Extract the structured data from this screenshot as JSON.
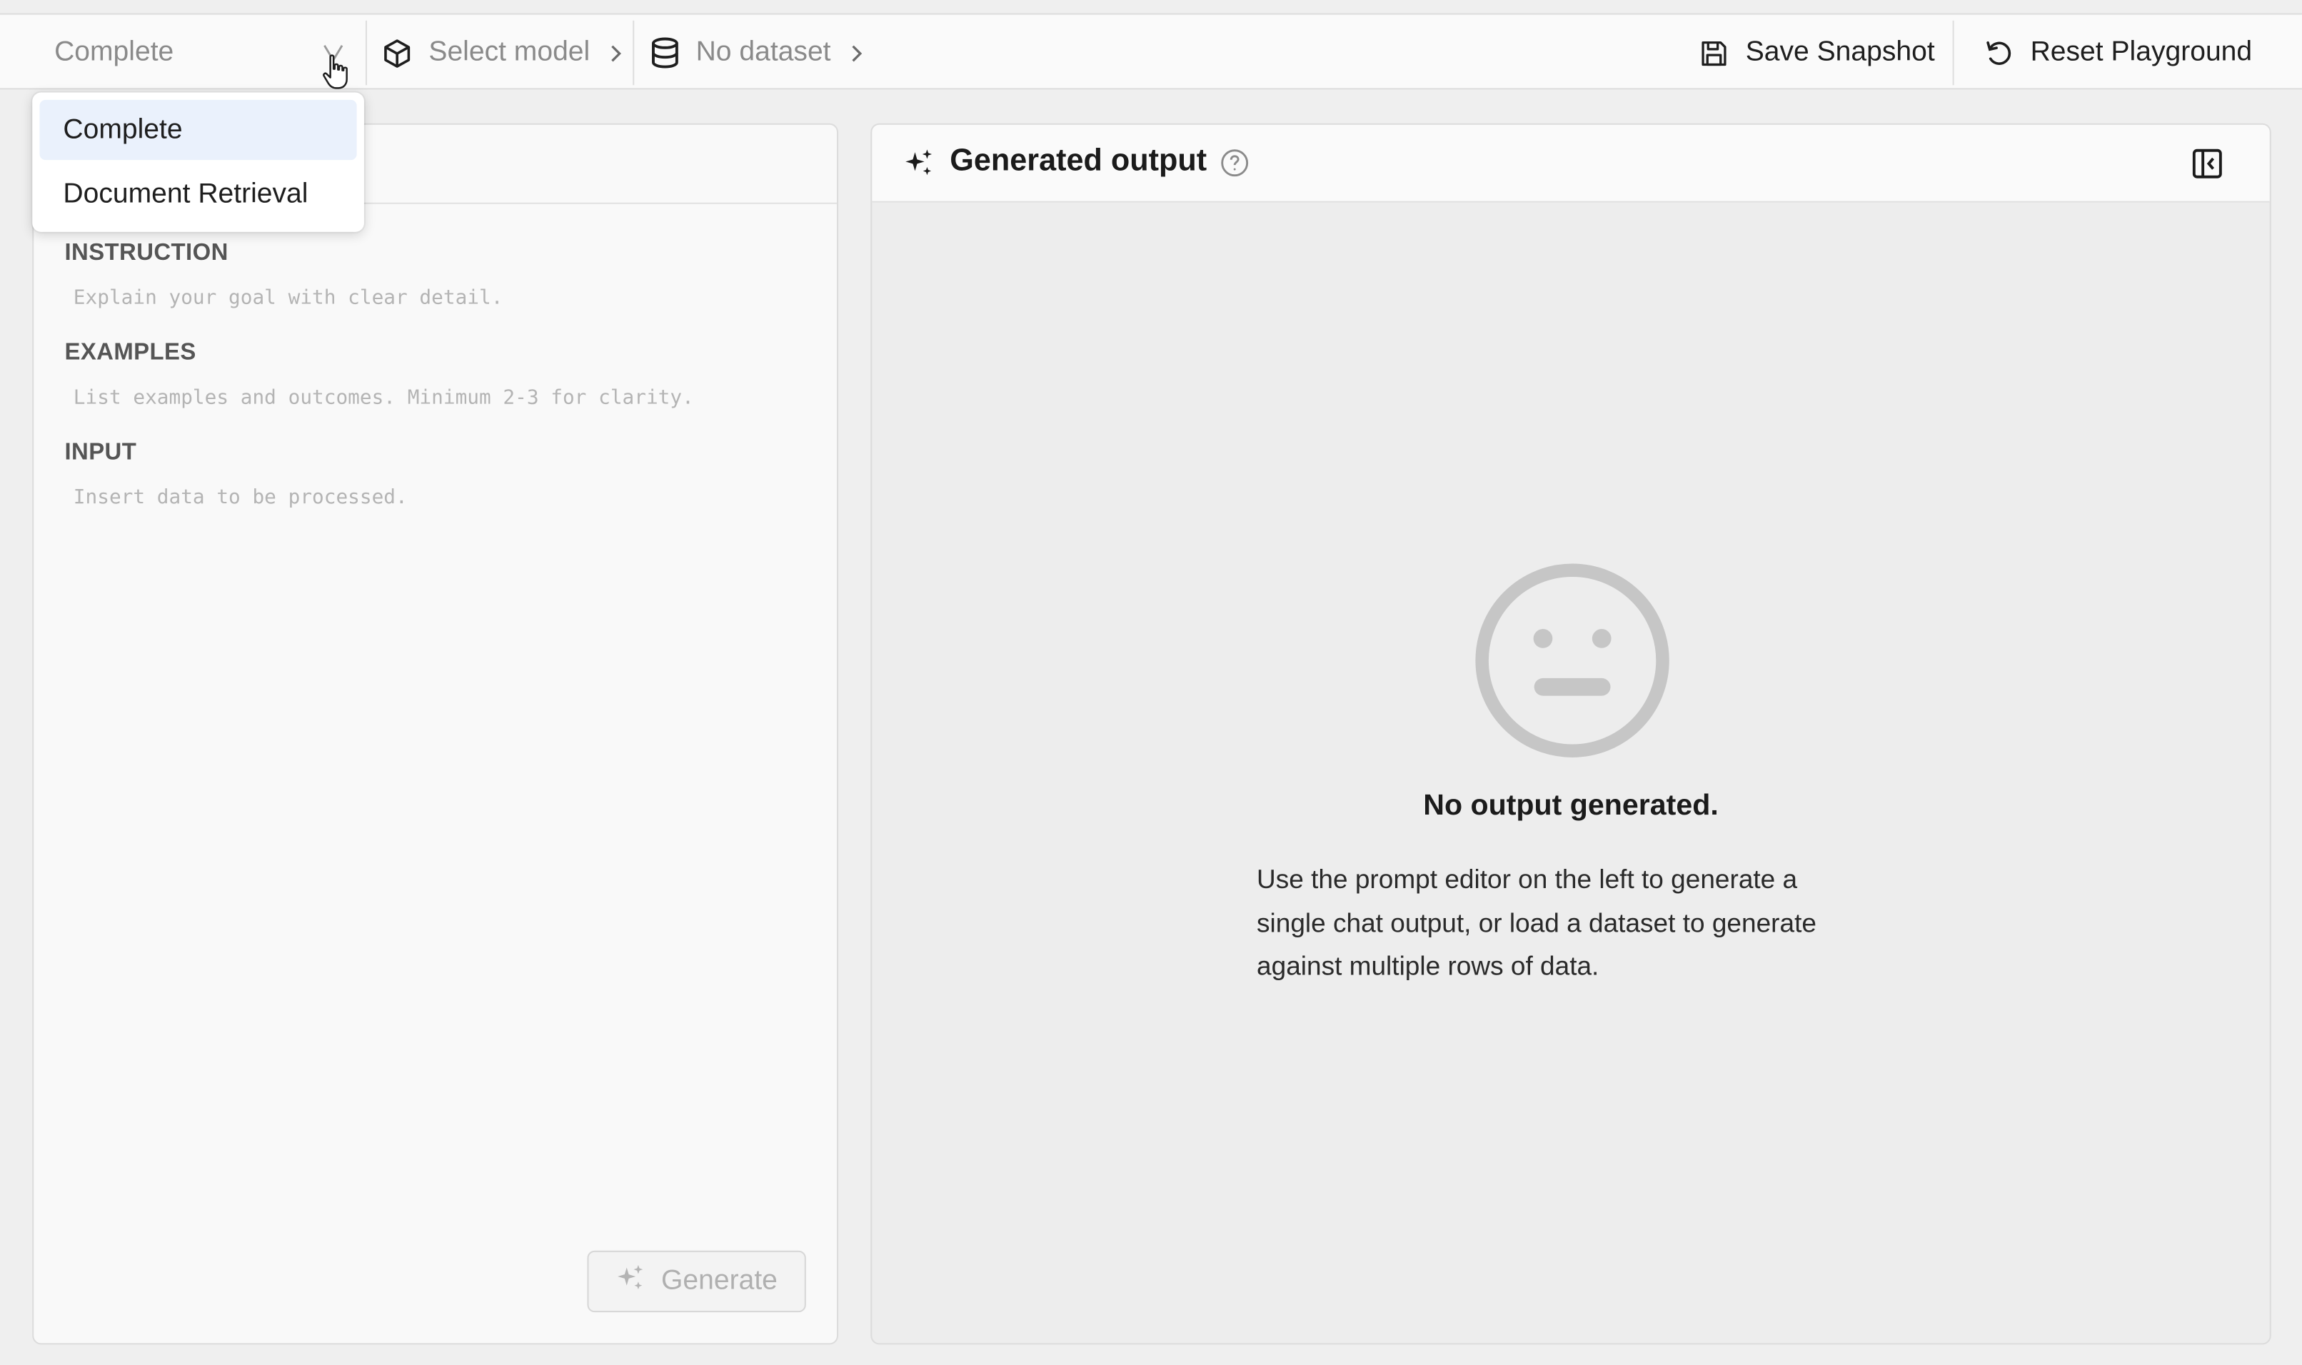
{
  "toolbar": {
    "mode_value": "Complete",
    "model_label": "Select model",
    "dataset_label": "No dataset",
    "save_label": "Save Snapshot",
    "reset_label": "Reset Playground"
  },
  "mode_dropdown": {
    "options": [
      {
        "label": "Complete",
        "selected": true
      },
      {
        "label": "Document Retrieval",
        "selected": false
      }
    ]
  },
  "prompt_editor": {
    "sections": [
      {
        "label": "INSTRUCTION",
        "placeholder": "Explain your goal with clear detail."
      },
      {
        "label": "EXAMPLES",
        "placeholder": "List examples and outcomes. Minimum 2-3 for clarity."
      },
      {
        "label": "INPUT",
        "placeholder": "Insert data to be processed."
      }
    ],
    "generate_label": "Generate"
  },
  "output_panel": {
    "title": "Generated output",
    "empty_title": "No output generated.",
    "empty_description": "Use the prompt editor on the left to generate a single chat output, or load a dataset to generate against multiple rows of data."
  },
  "icons": {
    "mode": "chevron-down-icon",
    "model": "cube-icon",
    "dataset": "database-icon",
    "save": "save-icon",
    "reset": "reset-icon",
    "output": "sparkles-icon",
    "help": "help-circle-icon",
    "sidebar_toggle": "panel-toggle-icon",
    "empty_state": "neutral-face-icon"
  }
}
